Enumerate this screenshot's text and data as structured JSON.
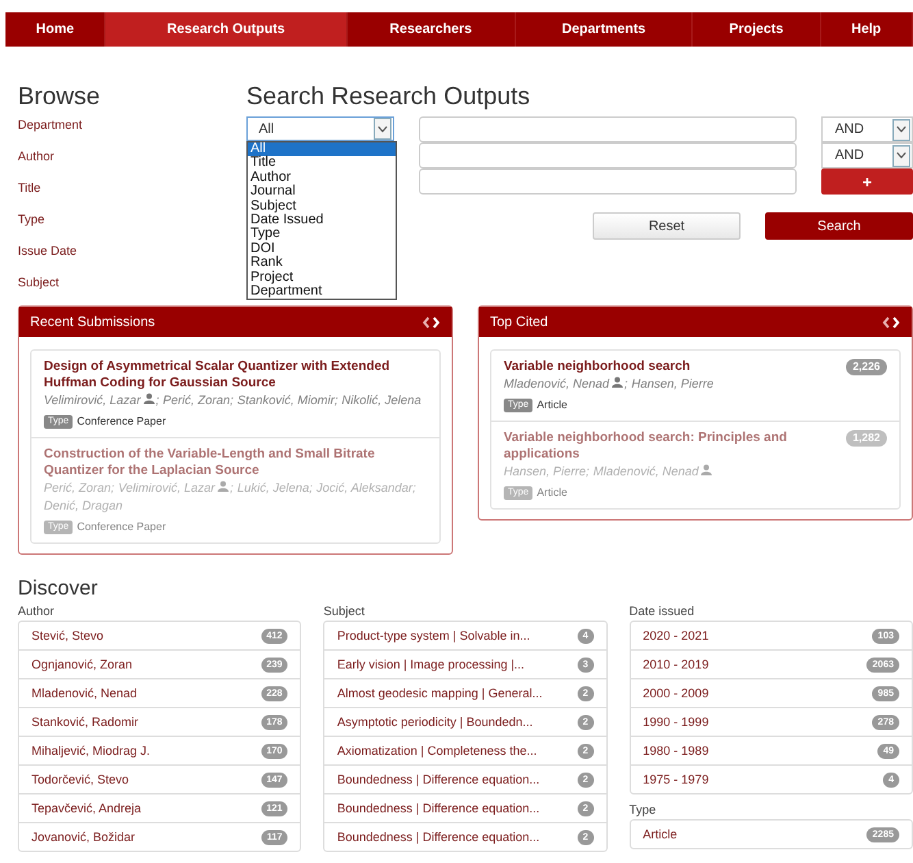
{
  "nav": [
    {
      "label": "Home",
      "selected": false
    },
    {
      "label": "Research Outputs",
      "selected": true
    },
    {
      "label": "Researchers",
      "selected": false
    },
    {
      "label": "Departments",
      "selected": false
    },
    {
      "label": "Projects",
      "selected": false
    },
    {
      "label": "Help",
      "selected": false
    }
  ],
  "browse": {
    "title": "Browse",
    "links": [
      "Department",
      "Author",
      "Title",
      "Type",
      "Issue Date",
      "Subject"
    ]
  },
  "search": {
    "title": "Search Research Outputs",
    "field_select": {
      "value": "All",
      "expanded": true,
      "options": [
        {
          "label": "All",
          "selected": true
        },
        {
          "label": "Title",
          "selected": false
        },
        {
          "label": "Author",
          "selected": false
        },
        {
          "label": "Journal",
          "selected": false
        },
        {
          "label": "Subject",
          "selected": false
        },
        {
          "label": "Date Issued",
          "selected": false
        },
        {
          "label": "Type",
          "selected": false
        },
        {
          "label": "DOI",
          "selected": false
        },
        {
          "label": "Rank",
          "selected": false
        },
        {
          "label": "Project",
          "selected": false
        },
        {
          "label": "Department",
          "selected": false
        }
      ]
    },
    "operators": [
      "AND",
      "AND"
    ],
    "add_button": "+",
    "reset_button": "Reset",
    "search_button": "Search"
  },
  "panels": [
    {
      "title": "Recent Submissions",
      "items": [
        {
          "title": "Design of Asymmetrical Scalar Quantizer with Extended Huffman Coding for Gaussian Source",
          "active": true,
          "authors": [
            {
              "name": "Velimirović, Lazar",
              "profile": true,
              "sep": ";"
            },
            {
              "name": "Perić, Zoran",
              "profile": false,
              "sep": ";"
            },
            {
              "name": "Stanković, Miomir",
              "profile": false,
              "sep": ";"
            },
            {
              "name": "Nikolić, Jelena",
              "profile": false
            }
          ],
          "type_label": "Type",
          "type": "Conference Paper"
        },
        {
          "title": "Construction of the Variable-Length and Small Bitrate Quantizer for the Laplacian Source",
          "active": false,
          "authors": [
            {
              "name": "Perić, Zoran",
              "profile": false,
              "sep": ";"
            },
            {
              "name": "Velimirović, Lazar",
              "profile": true,
              "sep": ";"
            },
            {
              "name": "Lukić, Jelena",
              "profile": false,
              "sep": ";"
            },
            {
              "name": "Jocić, Aleksandar",
              "profile": false,
              "sep": ";"
            },
            {
              "name": "Denić, Dragan",
              "profile": false
            }
          ],
          "type_label": "Type",
          "type": "Conference Paper"
        }
      ]
    },
    {
      "title": "Top Cited",
      "items": [
        {
          "title": "Variable neighborhood search",
          "active": true,
          "citations": "2,226",
          "authors": [
            {
              "name": "Mladenović, Nenad",
              "profile": true,
              "sep": ";"
            },
            {
              "name": "Hansen, Pierre",
              "profile": false
            }
          ],
          "type_label": "Type",
          "type": "Article"
        },
        {
          "title": "Variable neighborhood search: Principles and applications",
          "active": false,
          "citations": "1,282",
          "authors": [
            {
              "name": "Hansen, Pierre",
              "profile": false,
              "sep": ";"
            },
            {
              "name": "Mladenović, Nenad",
              "profile": true
            }
          ],
          "type_label": "Type",
          "type": "Article"
        }
      ]
    }
  ],
  "discover": {
    "title": "Discover",
    "columns": [
      {
        "groups": [
          {
            "heading": "Author",
            "items": [
              {
                "label": "Stević, Stevo",
                "count": "412"
              },
              {
                "label": "Ognjanović, Zoran",
                "count": "239"
              },
              {
                "label": "Mladenović, Nenad",
                "count": "228"
              },
              {
                "label": "Stanković, Radomir",
                "count": "178"
              },
              {
                "label": "Mihaljević, Miodrag J.",
                "count": "170"
              },
              {
                "label": "Todorčević, Stevo",
                "count": "147"
              },
              {
                "label": "Tepavčević, Andreja",
                "count": "121"
              },
              {
                "label": "Jovanović, Božidar",
                "count": "117"
              }
            ]
          }
        ]
      },
      {
        "groups": [
          {
            "heading": "Subject",
            "items": [
              {
                "label": "Product-type system | Solvable in...",
                "count": "4"
              },
              {
                "label": "Early vision | Image processing |...",
                "count": "3"
              },
              {
                "label": "Almost geodesic mapping | General...",
                "count": "2"
              },
              {
                "label": "Asymptotic periodicity | Boundedn...",
                "count": "2"
              },
              {
                "label": "Axiomatization | Completeness the...",
                "count": "2"
              },
              {
                "label": "Boundedness | Difference equation...",
                "count": "2"
              },
              {
                "label": "Boundedness | Difference equation...",
                "count": "2"
              },
              {
                "label": "Boundedness | Difference equation...",
                "count": "2"
              }
            ]
          }
        ]
      },
      {
        "groups": [
          {
            "heading": "Date issued",
            "items": [
              {
                "label": "2020 - 2021",
                "count": "103"
              },
              {
                "label": "2010 - 2019",
                "count": "2063"
              },
              {
                "label": "2000 - 2009",
                "count": "985"
              },
              {
                "label": "1990 - 1999",
                "count": "278"
              },
              {
                "label": "1980 - 1989",
                "count": "49"
              },
              {
                "label": "1975 - 1979",
                "count": "4"
              }
            ]
          },
          {
            "heading": "Type",
            "items": [
              {
                "label": "Article",
                "count": "2285"
              }
            ]
          }
        ]
      }
    ]
  }
}
